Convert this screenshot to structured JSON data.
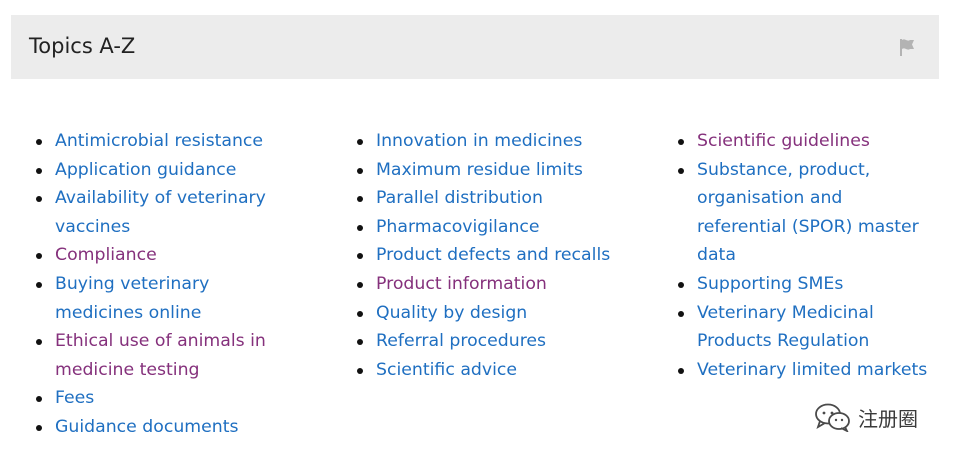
{
  "header": {
    "title": "Topics A-Z",
    "flag_icon": "flag-icon"
  },
  "colors": {
    "link": "#1f6fc1",
    "visited": "#85317c",
    "header_bg": "#ececec"
  },
  "columns": [
    [
      {
        "lines": [
          "Antimicrobial resistance"
        ],
        "visited": false
      },
      {
        "lines": [
          "Application guidance"
        ],
        "visited": false
      },
      {
        "lines": [
          "Availability of veterinary",
          "vaccines"
        ],
        "visited": false
      },
      {
        "lines": [
          "Compliance"
        ],
        "visited": true
      },
      {
        "lines": [
          "Buying veterinary",
          "medicines online"
        ],
        "visited": false
      },
      {
        "lines": [
          "Ethical use of animals in",
          "medicine testing"
        ],
        "visited": true
      },
      {
        "lines": [
          "Fees"
        ],
        "visited": false
      },
      {
        "lines": [
          "Guidance documents"
        ],
        "visited": false
      }
    ],
    [
      {
        "lines": [
          "Innovation in medicines"
        ],
        "visited": false
      },
      {
        "lines": [
          "Maximum residue limits"
        ],
        "visited": false
      },
      {
        "lines": [
          "Parallel distribution"
        ],
        "visited": false
      },
      {
        "lines": [
          "Pharmacovigilance"
        ],
        "visited": false
      },
      {
        "lines": [
          "Product defects and recalls"
        ],
        "visited": false
      },
      {
        "lines": [
          "Product information"
        ],
        "visited": true
      },
      {
        "lines": [
          "Quality by design"
        ],
        "visited": false
      },
      {
        "lines": [
          "Referral procedures"
        ],
        "visited": false
      },
      {
        "lines": [
          "Scientific advice"
        ],
        "visited": false
      }
    ],
    [
      {
        "lines": [
          "Scientific guidelines"
        ],
        "visited": true
      },
      {
        "lines": [
          "Substance, product,",
          "organisation and",
          "referential (SPOR) master",
          "data"
        ],
        "visited": false
      },
      {
        "lines": [
          "Supporting SMEs"
        ],
        "visited": false
      },
      {
        "lines": [
          "Veterinary Medicinal",
          "Products Regulation"
        ],
        "visited": false
      },
      {
        "lines": [
          "Veterinary limited markets"
        ],
        "visited": false
      }
    ]
  ],
  "watermark": {
    "text": "注册圈",
    "icon": "wechat-icon"
  }
}
